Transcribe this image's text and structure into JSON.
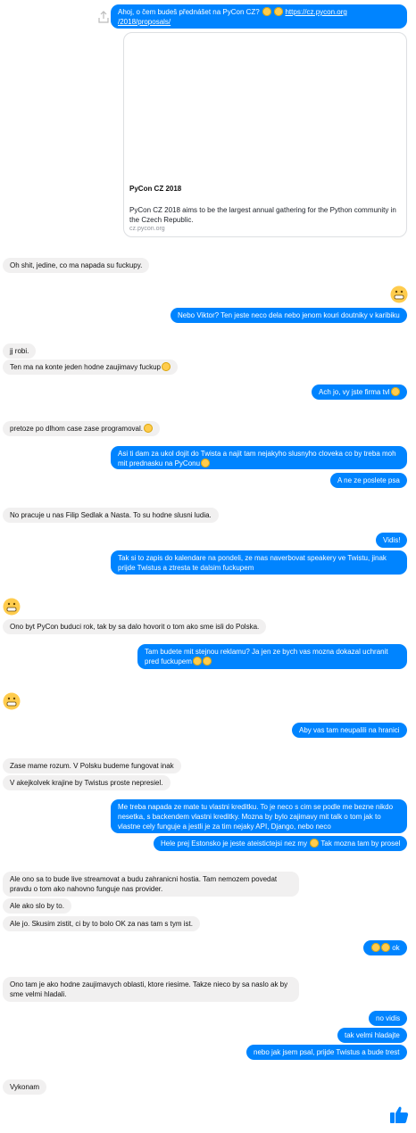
{
  "colors": {
    "outgoing": "#0084ff",
    "incoming": "#f1f0f0",
    "emoji": "#ffcc4d"
  },
  "first_message": {
    "text": "Ahoj, o čem budeš přednášet na PyCon CZ?",
    "link_line1": "https://cz.pycon.org",
    "link_line2": "/2018/proposals/"
  },
  "link_card": {
    "title": "PyCon CZ 2018",
    "description": "PyCon CZ 2018 aims to be the largest annual gathering for the Python community in the Czech Republic.",
    "domain": "cz.pycon.org"
  },
  "messages": [
    "Oh shit, jedine, co ma napada su fuckupy.",
    "Nebo Viktor? Ten jeste neco dela nebo jenom kouri doutniky v karibiku",
    "jj robi.",
    "Ten ma na konte jeden hodne zaujimavy fuckup",
    "Ach jo, vy jste firma tvl",
    "pretoze po dlhom case zase programoval.",
    "Asi ti dam za ukol dojit do Twista a najit tam nejakyho slusnyho cloveka co by treba moh mit prednasku na PyConu",
    "A ne ze poslete psa",
    "No pracuje u nas Filip Sedlak a Nasta. To su hodne slusni ludia.",
    "Vidis!",
    "Tak si to zapis do kalendare na pondeli, ze mas naverbovat speakery ve Twistu, jinak prijde Twistus a ztresta te dalsim fuckupem",
    "Ono byt PyCon buduci rok, tak by sa dalo hovorit o tom ako sme isli do Polska.",
    "Tam budete mit stejnou reklamu? Ja jen ze bych vas mozna dokazal uchranit pred fuckupem",
    "Aby vas tam neupalili na hranici",
    "Zase mame rozum. V Polsku budeme fungovat inak",
    "V akejkolvek krajine by Twistus proste nepresiel.",
    "Me treba napada ze mate tu vlastni kreditku. To je neco s cim se podle me bezne nikdo nesetka, s backendem vlastni kreditky. Mozna by bylo zajimavy mit talk o tom jak to vlastne cely funguje a jestli je za tim nejaky API, Django, nebo neco",
    "Hele prej Estonsko je jeste ateistictejsi nez my",
    "Tak mozna tam by prosel",
    "Ale ono sa to bude live streamovat a budu zahranicni hostia. Tam nemozem povedat pravdu o tom ako nahovno funguje nas provider.",
    "Ale ako slo by to.",
    "Ale jo. Skusim zistit, ci by to bolo OK za nas tam s tym ist.",
    "ok",
    "Ono tam je ako hodne zaujimavych oblasti, ktore riesime. Takze nieco by sa naslo ak by sme velmi hladali.",
    "no vidis",
    "tak velmi hladajte",
    "nebo jak jsem psal, prijde Twistus a bude trest",
    "Vykonam"
  ]
}
